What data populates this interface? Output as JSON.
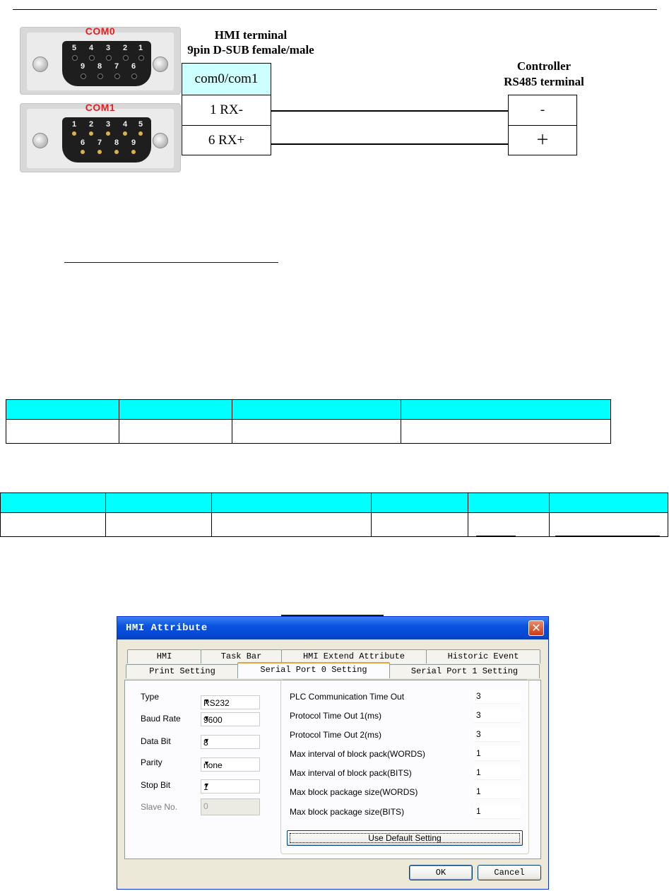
{
  "colors": {
    "table_header": "#00ffff",
    "diagram_header": "#ccffff",
    "com_label": "#e02020",
    "dialog_title_blue": "#0a53e0"
  },
  "connectors": {
    "com0": {
      "label": "COM0",
      "top_pins": [
        "5",
        "4",
        "3",
        "2",
        "1"
      ],
      "bottom_pins": [
        "9",
        "8",
        "7",
        "6"
      ]
    },
    "com1": {
      "label": "COM1",
      "top_pins": [
        "1",
        "2",
        "3",
        "4",
        "5"
      ],
      "bottom_pins": [
        "6",
        "7",
        "8",
        "9"
      ]
    }
  },
  "wiring": {
    "hmi_title_1": "HMI terminal",
    "hmi_title_2": "9pin D-SUB female/male",
    "hmi_header": "com0/com1",
    "hmi_pins": [
      "1 RX-",
      "6 RX+"
    ],
    "controller_title_1": "Controller",
    "controller_title_2": "RS485 terminal",
    "controller_pins": [
      "-",
      "＋"
    ]
  },
  "dialog": {
    "title": "HMI Attribute",
    "close_icon": "close-x-icon",
    "tabs_back": [
      "HMI",
      "Task Bar",
      "HMI Extend Attribute",
      "Historic Event"
    ],
    "tabs_front": [
      "Print Setting",
      "Serial Port 0 Setting",
      "Serial Port 1 Setting"
    ],
    "left_fields": [
      {
        "label": "Type",
        "value": "RS232"
      },
      {
        "label": "Baud Rate",
        "value": "9600"
      },
      {
        "label": "Data Bit",
        "value": "8"
      },
      {
        "label": "Parity",
        "value": "none"
      },
      {
        "label": "Stop Bit",
        "value": "1"
      }
    ],
    "slave_label": "Slave No.",
    "slave_value": "0",
    "right_fields": [
      {
        "label": "PLC Communication Time Out",
        "value": "3"
      },
      {
        "label": "Protocol Time Out 1(ms)",
        "value": "3"
      },
      {
        "label": "Protocol Time Out 2(ms)",
        "value": "3"
      },
      {
        "label": "Max interval of block pack(WORDS)",
        "value": "1"
      },
      {
        "label": "Max interval of block pack(BITS)",
        "value": "1"
      },
      {
        "label": "Max block package size(WORDS)",
        "value": "1"
      },
      {
        "label": "Max block package size(BITS)",
        "value": "1"
      }
    ],
    "default_button": "Use Default Setting",
    "ok_button": "OK",
    "cancel_button": "Cancel"
  }
}
